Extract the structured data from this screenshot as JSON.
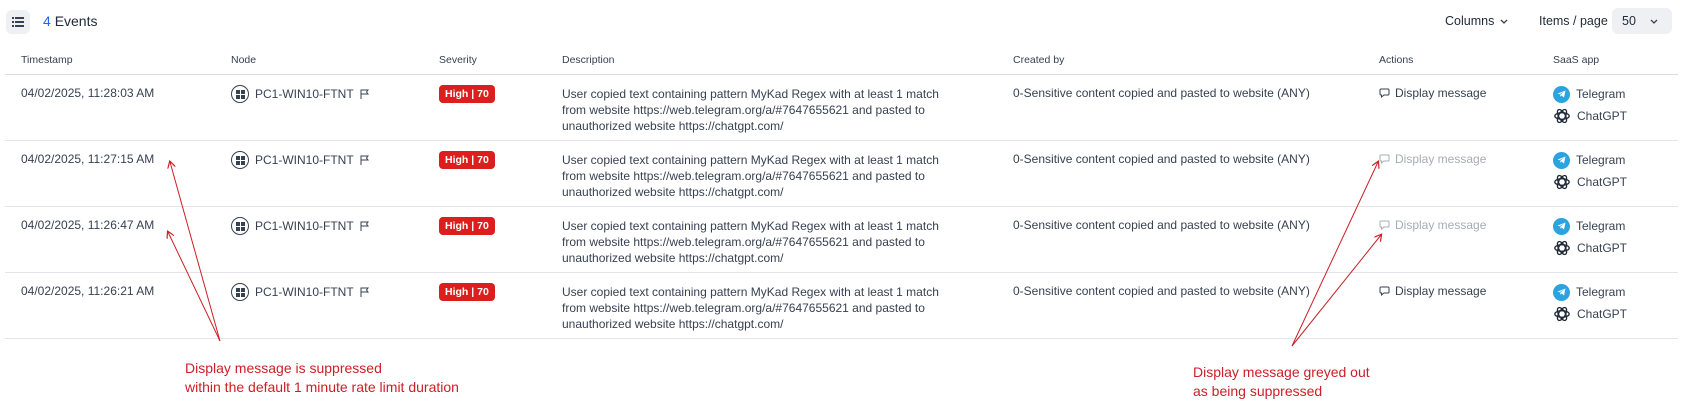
{
  "header": {
    "event_count": "4",
    "event_label": "Events",
    "columns_label": "Columns",
    "items_per_page_label": "Items / page",
    "items_per_page_value": "50"
  },
  "columns": {
    "timestamp": "Timestamp",
    "node": "Node",
    "severity": "Severity",
    "description": "Description",
    "created_by": "Created by",
    "actions": "Actions",
    "saas_app": "SaaS app"
  },
  "rows": [
    {
      "timestamp": "04/02/2025, 11:28:03 AM",
      "node": "PC1-WIN10-FTNT",
      "severity": "High | 70",
      "description": "User copied text containing pattern MyKad Regex with at least 1 match from website https://web.telegram.org/a/#7647655621 and pasted to unauthorized website https://chatgpt.com/",
      "created_by": "0-Sensitive content copied and pasted to website (ANY)",
      "action": "Display message",
      "action_suppressed": false,
      "apps": [
        "Telegram",
        "ChatGPT"
      ]
    },
    {
      "timestamp": "04/02/2025, 11:27:15 AM",
      "node": "PC1-WIN10-FTNT",
      "severity": "High | 70",
      "description": "User copied text containing pattern MyKad Regex with at least 1 match from website https://web.telegram.org/a/#7647655621 and pasted to unauthorized website https://chatgpt.com/",
      "created_by": "0-Sensitive content copied and pasted to website (ANY)",
      "action": "Display message",
      "action_suppressed": true,
      "apps": [
        "Telegram",
        "ChatGPT"
      ]
    },
    {
      "timestamp": "04/02/2025, 11:26:47 AM",
      "node": "PC1-WIN10-FTNT",
      "severity": "High | 70",
      "description": "User copied text containing pattern MyKad Regex with at least 1 match from website https://web.telegram.org/a/#7647655621 and pasted to unauthorized website https://chatgpt.com/",
      "created_by": "0-Sensitive content copied and pasted to website (ANY)",
      "action": "Display message",
      "action_suppressed": true,
      "apps": [
        "Telegram",
        "ChatGPT"
      ]
    },
    {
      "timestamp": "04/02/2025, 11:26:21 AM",
      "node": "PC1-WIN10-FTNT",
      "severity": "High | 70",
      "description": "User copied text containing pattern MyKad Regex with at least 1 match from website https://web.telegram.org/a/#7647655621 and pasted to unauthorized website https://chatgpt.com/",
      "created_by": "0-Sensitive content copied and pasted to website (ANY)",
      "action": "Display message",
      "action_suppressed": false,
      "apps": [
        "Telegram",
        "ChatGPT"
      ]
    }
  ],
  "annotations": {
    "left_line1": "Display message is suppressed",
    "left_line2": "within the default 1 minute rate limit duration",
    "right_line1": "Display message greyed out",
    "right_line2": "as being suppressed"
  },
  "colors": {
    "accent": "#2563eb",
    "severity_high": "#dc1e1e",
    "annotation": "#cc1f26",
    "telegram": "#2aa3de",
    "muted": "#a7acb4"
  },
  "icons": {
    "menu": "list-icon",
    "node": "windows-icon",
    "flag": "flag-icon",
    "action": "message-icon",
    "telegram": "telegram-icon",
    "chatgpt": "chatgpt-icon",
    "dropdown": "chevron-down-icon"
  }
}
